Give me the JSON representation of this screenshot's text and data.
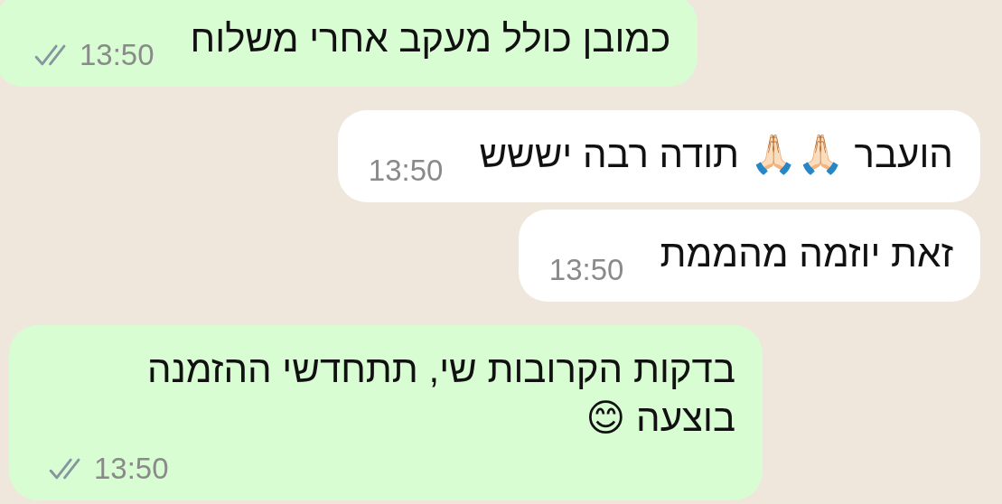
{
  "messages": [
    {
      "kind": "outgoing",
      "text": "כמובן כולל מעקב אחרי משלוח",
      "time": "13:50",
      "read": false
    },
    {
      "kind": "incoming",
      "text": "הועבר 🙏🏻🙏🏻 תודה רבה יששש",
      "time": "13:50"
    },
    {
      "kind": "incoming",
      "text": "זאת יוזמה מהממת",
      "time": "13:50"
    },
    {
      "kind": "outgoing",
      "text": "בדקות הקרובות שי, תתחדשי ההזמנה בוצעה 😊",
      "time": "13:50",
      "read": false
    }
  ]
}
